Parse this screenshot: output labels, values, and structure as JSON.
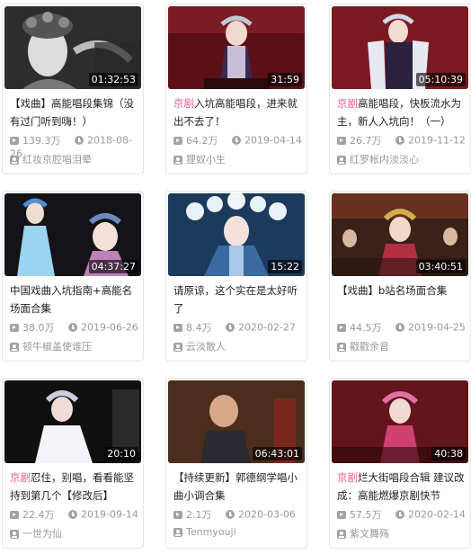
{
  "cards": [
    {
      "duration": "01:32:53",
      "tag": "",
      "title": "【戏曲】高能唱段集锦（没有过门听到嗨！）",
      "views": "139.3万",
      "date": "2018-08-26",
      "uploader": "红妆京腔唱泪晕",
      "thumb_bg": "#2a2a2a"
    },
    {
      "duration": "31:59",
      "tag": "京剧",
      "title": "入坑高能唱段，进来就出不去了！",
      "views": "64.2万",
      "date": "2019-04-14",
      "uploader": "狸奴小生",
      "thumb_bg": "#6a1a1e"
    },
    {
      "duration": "05:10:39",
      "tag": "京剧",
      "title": "高能唱段，快板流水为主，新人入坑向！（一）",
      "views": "26.7万",
      "date": "2019-11-12",
      "uploader": "红罗帐内淡淡心",
      "thumb_bg": "#7a1a20"
    },
    {
      "duration": "04:37:27",
      "tag": "",
      "title": "中国戏曲入坑指南+高能名场面合集",
      "views": "38.0万",
      "date": "2019-06-26",
      "uploader": "顿牛椒盖使谁压",
      "thumb_bg": "#1a1a22"
    },
    {
      "duration": "15:22",
      "tag": "",
      "title": "请原谅，这个实在是太好听了",
      "views": "8.4万",
      "date": "2020-02-27",
      "uploader": "云淡散人",
      "thumb_bg": "#1f3a5a"
    },
    {
      "duration": "03:40:51",
      "tag": "",
      "title": "【戏曲】b站名场面合集",
      "views": "44.5万",
      "date": "2019-04-25",
      "uploader": "戳戳余音",
      "thumb_bg": "#4a2a20"
    },
    {
      "duration": "20:10",
      "tag": "京剧",
      "title": "忍住，别唱，看看能坚持到第几个【修改后】",
      "views": "22.4万",
      "date": "2019-09-14",
      "uploader": "一世为仙",
      "thumb_bg": "#141414"
    },
    {
      "duration": "06:43:01",
      "tag": "",
      "title": "【持续更新】郭德纲学唱小曲小调合集",
      "views": "2.1万",
      "date": "2020-03-06",
      "uploader": "Tenmyouji",
      "thumb_bg": "#3a2418"
    },
    {
      "duration": "40:38",
      "tag": "京剧",
      "title": "烂大街唱段合辑 建议改成：高能燃爆京剧快节",
      "views": "57.5万",
      "date": "2020-02-14",
      "uploader": "紫文舞殇",
      "thumb_bg": "#5a1418"
    }
  ]
}
